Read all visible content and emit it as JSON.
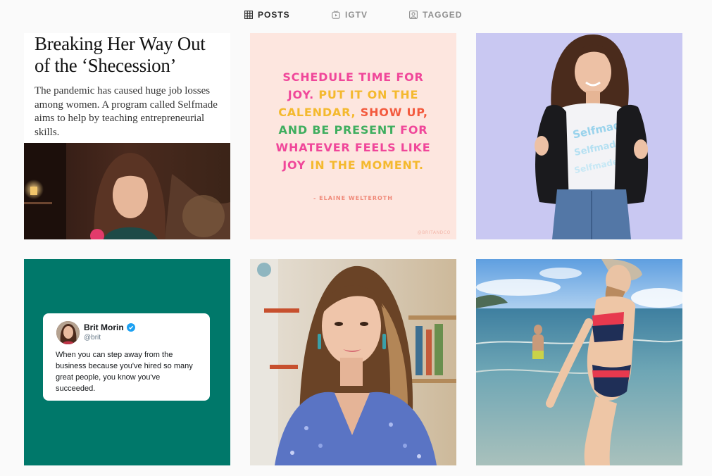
{
  "tabs": [
    {
      "label": "POSTS",
      "icon": "grid-icon",
      "active": true
    },
    {
      "label": "IGTV",
      "icon": "igtv-icon",
      "active": false
    },
    {
      "label": "TAGGED",
      "icon": "tagged-icon",
      "active": false
    }
  ],
  "posts": {
    "article": {
      "headline": "Breaking Her Way Out of the ‘Shecession’",
      "dek": "The pandemic has caused huge job losses among women. A program called Selfmade aims to help by teaching entrepreneurial skills."
    },
    "quote": {
      "line1": "SCHEDULE TIME FOR",
      "line2a": "JOY. ",
      "line2b": "PUT IT ON THE",
      "line3a": "CALENDAR, ",
      "line3b": "SHOW UP,",
      "line4a": "AND BE PRESENT ",
      "line4b": "FOR",
      "line5": "WHATEVER FEELS LIKE",
      "line6a": "JOY ",
      "line6b": "IN THE MOMENT.",
      "attribution": "- ELAINE WELTEROTH",
      "watermark": "@BRITANDCO",
      "colors": {
        "pink": "#f0479a",
        "yellow": "#f4b92e",
        "orange": "#f35a3e",
        "green": "#3fae5f",
        "background": "#fde6df"
      }
    },
    "tweet": {
      "name": "Brit Morin",
      "handle": "@brit",
      "text": "When you can step away from the business because you've hired so many great people, you know you've succeeded.",
      "background": "#00786a"
    }
  }
}
